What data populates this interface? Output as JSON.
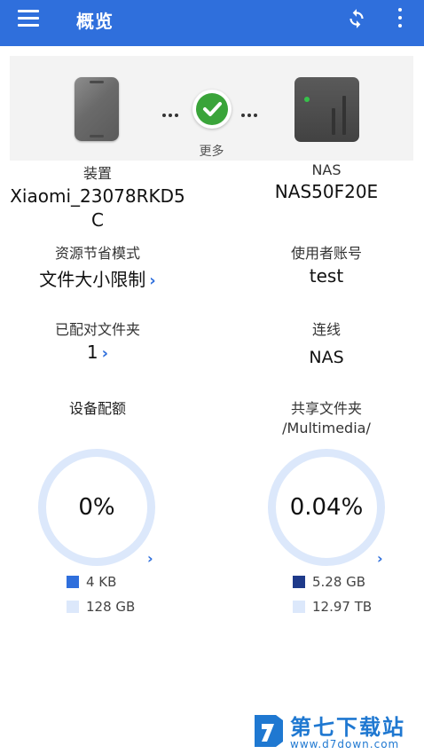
{
  "appbar": {
    "title": "概览",
    "menu_icon": "menu-icon",
    "refresh_icon": "refresh-icon",
    "more_icon": "more-vert-icon",
    "color": "#2f6fdc"
  },
  "connection": {
    "more_label": "更多",
    "status_color": "#3aa43a"
  },
  "device": {
    "label": "装置",
    "name_line1": "Xiaomi_23078RKD5",
    "name_line2": "C"
  },
  "nas": {
    "label": "NAS",
    "name": "NAS50F20E"
  },
  "power_mode": {
    "label": "资源节省模式",
    "value": "文件大小限制"
  },
  "account": {
    "label": "使用者账号",
    "value": "test"
  },
  "paired_folders": {
    "label": "已配对文件夹",
    "value": "1"
  },
  "connection_type": {
    "label": "连线",
    "value": "NAS"
  },
  "device_quota": {
    "label": "设备配额",
    "percent_text": "0%",
    "used": "4 KB",
    "total": "128 GB",
    "used_color": "#2f6fdc",
    "total_color": "#dce8fb"
  },
  "shared_folder": {
    "label": "共享文件夹",
    "path": "/Multimedia/",
    "percent_text": "0.04%",
    "used": "5.28 GB",
    "total": "12.97 TB",
    "used_color": "#1e3a8a",
    "total_color": "#dce8fb"
  },
  "watermark": {
    "title": "第七下载站",
    "url": "www.d7down.com"
  }
}
